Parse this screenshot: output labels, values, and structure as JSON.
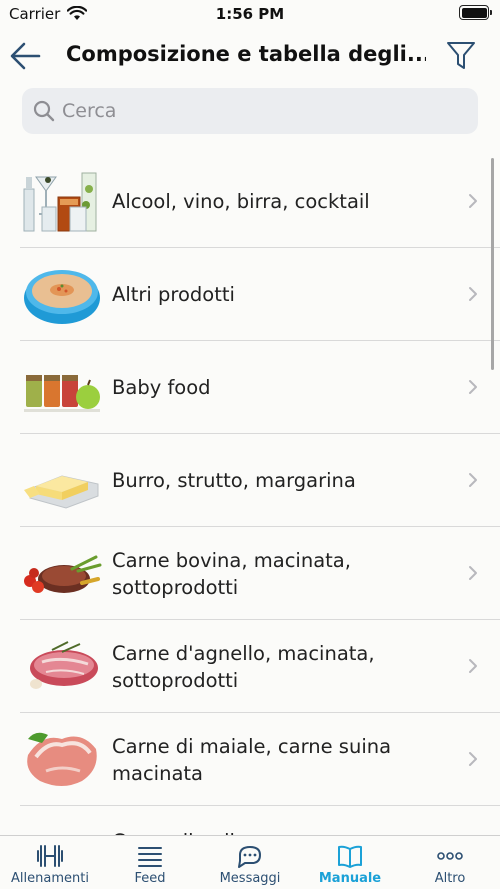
{
  "status_bar": {
    "carrier": "Carrier",
    "time": "1:56 PM"
  },
  "header": {
    "title": "Composizione e tabella degli..."
  },
  "search": {
    "placeholder": "Cerca"
  },
  "categories": [
    {
      "label": "Alcool, vino, birra, cocktail",
      "icon": "drinks-image"
    },
    {
      "label": "Altri prodotti",
      "icon": "soup-bowl-image"
    },
    {
      "label": "Baby food",
      "icon": "baby-food-jars-image"
    },
    {
      "label": "Burro, strutto, margarina",
      "icon": "butter-image"
    },
    {
      "label": "Carne bovina, macinata, sottoprodotti",
      "icon": "beef-steak-image"
    },
    {
      "label": "Carne d'agnello, macinata, sottoprodotti",
      "icon": "lamb-meat-image"
    },
    {
      "label": "Carne di maiale, carne suina macinata",
      "icon": "pork-chop-image"
    },
    {
      "label": "Carne di pollame...",
      "icon": "poultry-image"
    }
  ],
  "tabs": [
    {
      "label": "Allenamenti",
      "icon": "dumbbell-icon",
      "active": false
    },
    {
      "label": "Feed",
      "icon": "feed-lines-icon",
      "active": false
    },
    {
      "label": "Messaggi",
      "icon": "chat-bubbles-icon",
      "active": false
    },
    {
      "label": "Manuale",
      "icon": "book-icon",
      "active": true
    },
    {
      "label": "Altro",
      "icon": "more-dots-icon",
      "active": false
    }
  ],
  "colors": {
    "accent": "#1ba1d7",
    "tab_inactive": "#2c4f72",
    "back_arrow": "#2c4f72",
    "background": "#fbfbf9",
    "separator": "#d9d9d9"
  }
}
